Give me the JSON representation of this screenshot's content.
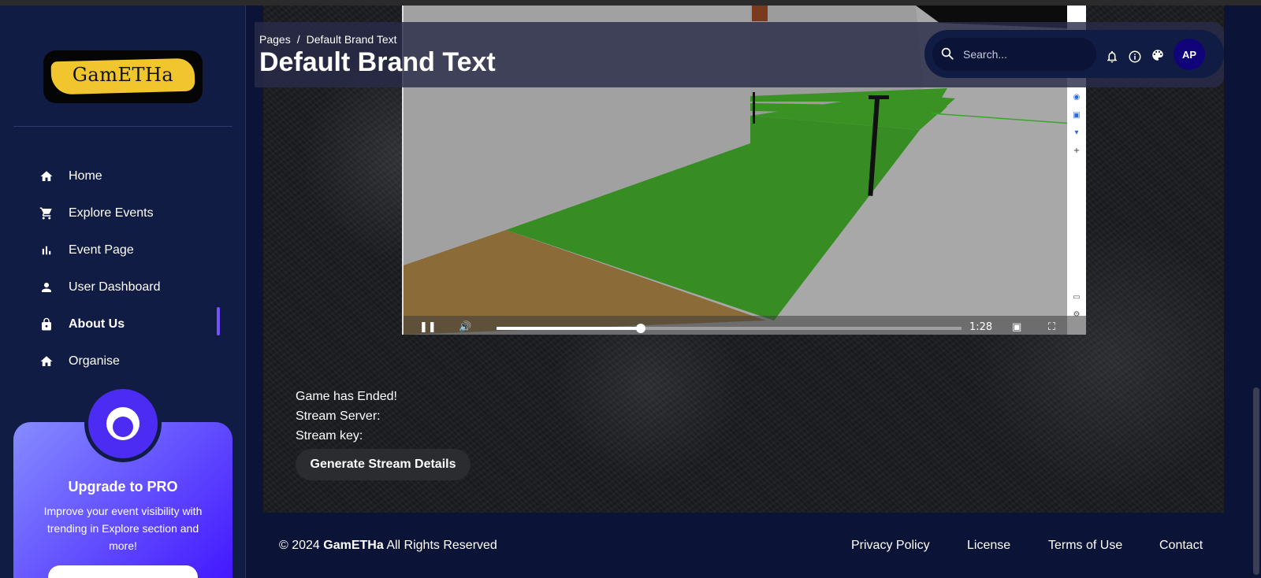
{
  "brand": {
    "logo_text": "GamETHa"
  },
  "sidebar": {
    "items": [
      {
        "label": "Home",
        "icon": "home-icon"
      },
      {
        "label": "Explore Events",
        "icon": "cart-icon"
      },
      {
        "label": "Event Page",
        "icon": "bar-chart-icon"
      },
      {
        "label": "User Dashboard",
        "icon": "person-icon"
      },
      {
        "label": "About Us",
        "icon": "lock-icon",
        "active": true
      },
      {
        "label": "Organise",
        "icon": "home-icon"
      }
    ],
    "pro_card": {
      "title": "Upgrade to PRO",
      "description": "Improve your event visibility with trending in Explore section and more!"
    }
  },
  "header": {
    "breadcrumb_root": "Pages",
    "breadcrumb_separator": "/",
    "breadcrumb_current": "Default Brand Text",
    "title": "Default Brand Text",
    "search_placeholder": "Search...",
    "avatar_initials": "AP"
  },
  "video": {
    "time_label": "1:28",
    "progress": 0.31
  },
  "stream": {
    "status": "Game has Ended!",
    "server_label": "Stream Server:",
    "key_label": "Stream key:",
    "generate_button": "Generate Stream Details"
  },
  "footer": {
    "copyright_prefix": "© 2024",
    "copyright_brand": "GamETHa",
    "copyright_suffix": "All Rights Reserved",
    "links": [
      "Privacy Policy",
      "License",
      "Terms of Use",
      "Contact"
    ]
  },
  "colors": {
    "sidebar_bg": "#111c44",
    "page_bg": "#0b1437",
    "accent": "#7551ff",
    "pro_gradient_start": "#868cff",
    "pro_gradient_end": "#4318ff",
    "avatar_bg": "#11047a"
  }
}
